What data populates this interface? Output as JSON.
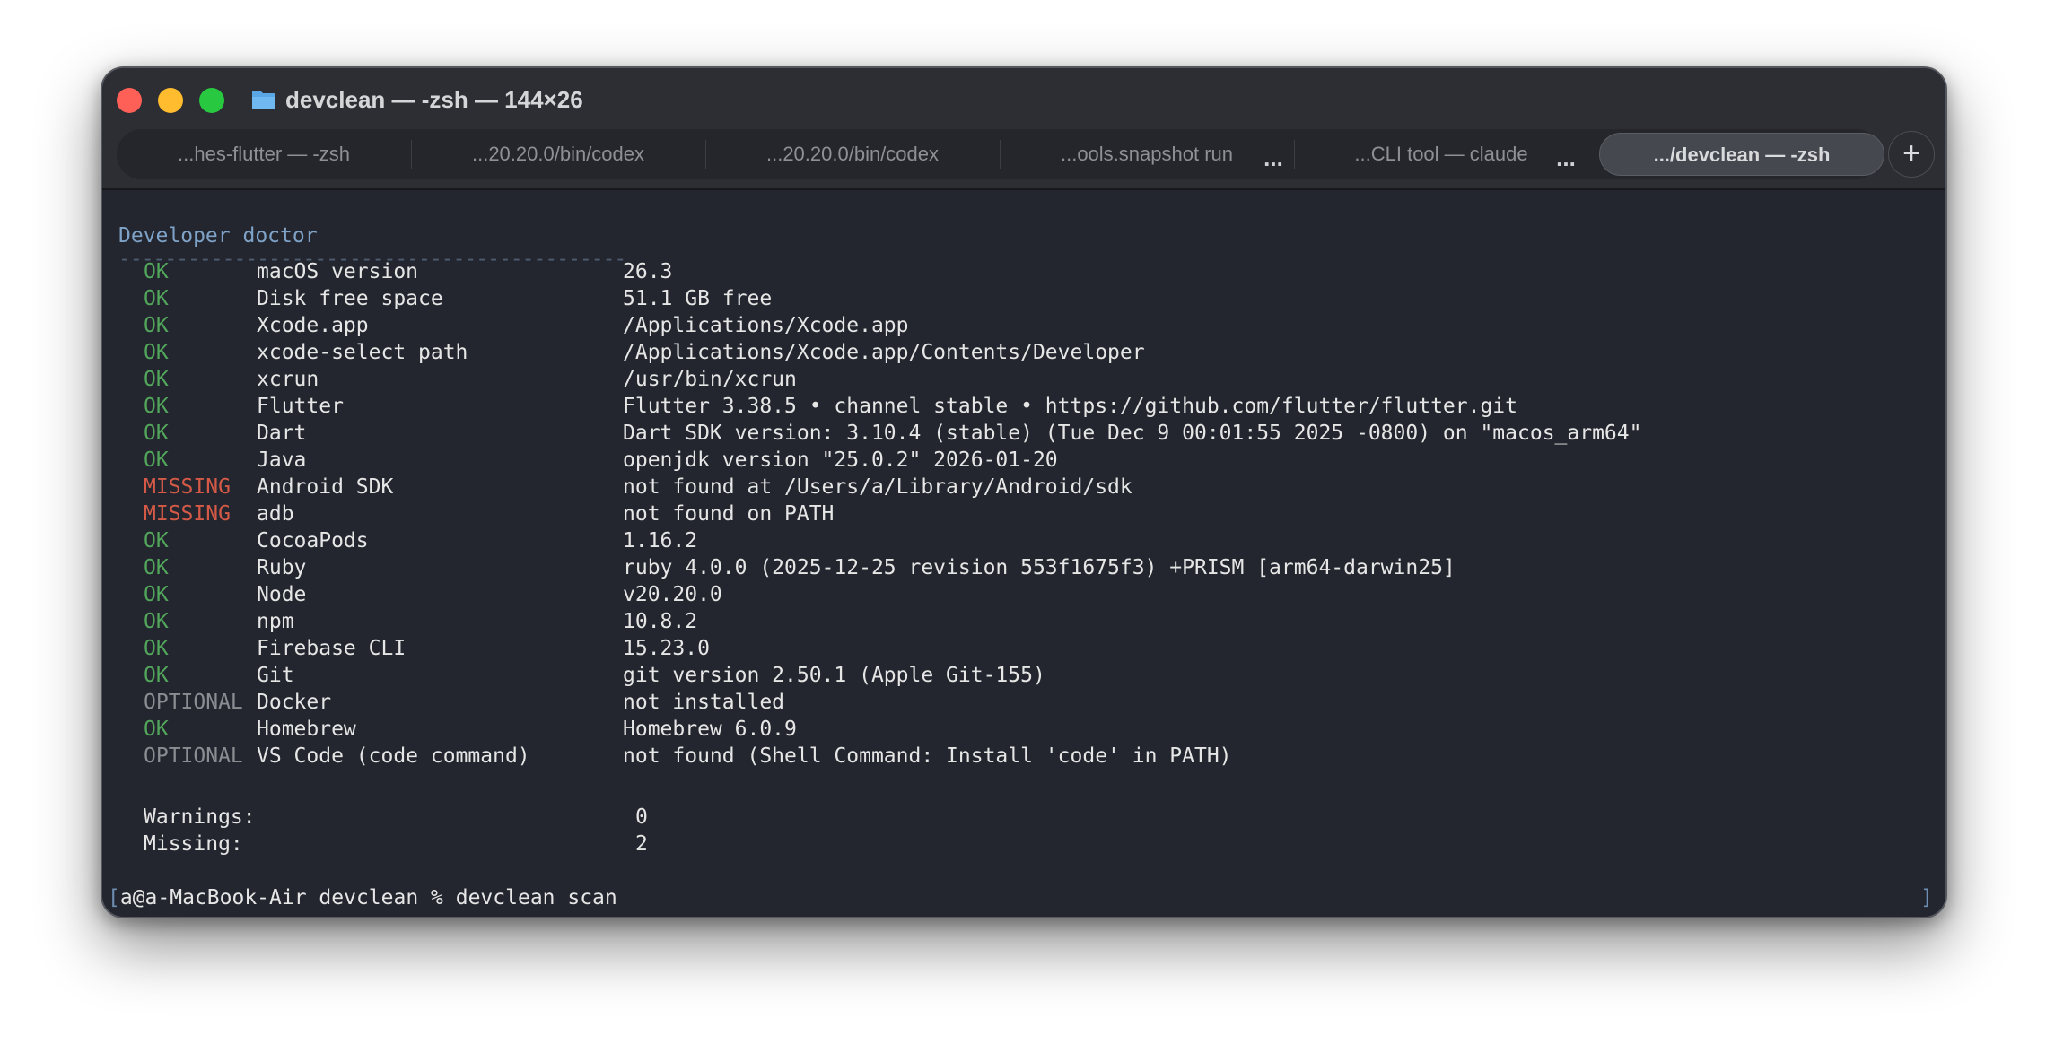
{
  "window": {
    "title": "devclean — -zsh — 144×26"
  },
  "tabs": [
    {
      "label": "...hes-flutter — -zsh"
    },
    {
      "label": "...20.20.0/bin/codex"
    },
    {
      "label": "...20.20.0/bin/codex"
    },
    {
      "label": "...ools.snapshot run"
    },
    {
      "label": "...CLI tool — claude"
    },
    {
      "label": ".../devclean — -zsh",
      "active": true
    }
  ],
  "tab_more_label": "...",
  "new_tab_label": "+",
  "terminal": {
    "heading": "Developer doctor",
    "rule": "--------------------------------------------",
    "checks": [
      {
        "status": "OK",
        "name": "macOS version",
        "value": "26.3"
      },
      {
        "status": "OK",
        "name": "Disk free space",
        "value": "51.1 GB free"
      },
      {
        "status": "OK",
        "name": "Xcode.app",
        "value": "/Applications/Xcode.app"
      },
      {
        "status": "OK",
        "name": "xcode-select path",
        "value": "/Applications/Xcode.app/Contents/Developer"
      },
      {
        "status": "OK",
        "name": "xcrun",
        "value": "/usr/bin/xcrun"
      },
      {
        "status": "OK",
        "name": "Flutter",
        "value": "Flutter 3.38.5 • channel stable • https://github.com/flutter/flutter.git"
      },
      {
        "status": "OK",
        "name": "Dart",
        "value": "Dart SDK version: 3.10.4 (stable) (Tue Dec 9 00:01:55 2025 -0800) on \"macos_arm64\""
      },
      {
        "status": "OK",
        "name": "Java",
        "value": "openjdk version \"25.0.2\" 2026-01-20"
      },
      {
        "status": "MISSING",
        "name": "Android SDK",
        "value": "not found at /Users/a/Library/Android/sdk"
      },
      {
        "status": "MISSING",
        "name": "adb",
        "value": "not found on PATH"
      },
      {
        "status": "OK",
        "name": "CocoaPods",
        "value": "1.16.2"
      },
      {
        "status": "OK",
        "name": "Ruby",
        "value": "ruby 4.0.0 (2025-12-25 revision 553f1675f3) +PRISM [arm64-darwin25]"
      },
      {
        "status": "OK",
        "name": "Node",
        "value": "v20.20.0"
      },
      {
        "status": "OK",
        "name": "npm",
        "value": "10.8.2"
      },
      {
        "status": "OK",
        "name": "Firebase CLI",
        "value": "15.23.0"
      },
      {
        "status": "OK",
        "name": "Git",
        "value": "git version 2.50.1 (Apple Git-155)"
      },
      {
        "status": "OPTIONAL",
        "name": "Docker",
        "value": "not installed"
      },
      {
        "status": "OK",
        "name": "Homebrew",
        "value": "Homebrew 6.0.9"
      },
      {
        "status": "OPTIONAL",
        "name": "VS Code (code command)",
        "value": "not found (Shell Command: Install 'code' in PATH)"
      }
    ],
    "summary": {
      "warnings_label": "Warnings:",
      "warnings_value": "0",
      "missing_label": "Missing:",
      "missing_value": "2"
    },
    "prompt": "a@a-MacBook-Air devclean % devclean scan",
    "bracket_left": "[",
    "bracket_right": "]"
  },
  "colors": {
    "ok": "#52a65b",
    "missing": "#d45a47",
    "optional": "#8a8d92",
    "heading": "#7fa3c8",
    "background": "#23262e"
  },
  "icons": {
    "folder": "folder-icon",
    "close": "close-button",
    "minimize": "minimize-button",
    "zoom": "zoom-button"
  }
}
